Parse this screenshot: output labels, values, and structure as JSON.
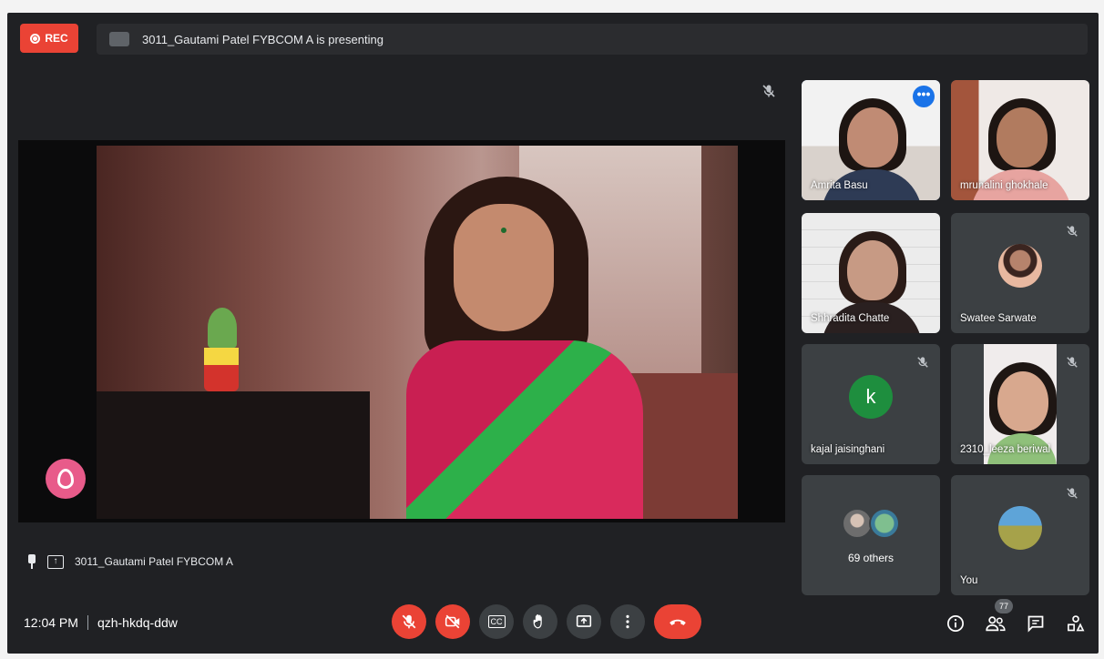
{
  "recording": {
    "label": "REC"
  },
  "presenting_banner": {
    "text": "3011_Gautami Patel FYBCOM A is presenting"
  },
  "presenter_caption": {
    "name": "3011_Gautami Patel FYBCOM A"
  },
  "participants": [
    {
      "name": "Amrita Basu",
      "kind": "video",
      "active": true,
      "muted": false
    },
    {
      "name": "mrunalini ghokhale",
      "kind": "video",
      "active": false,
      "muted": false
    },
    {
      "name": "Shhradita Chatte",
      "kind": "video",
      "active": false,
      "muted": false
    },
    {
      "name": "Swatee Sarwate",
      "kind": "avatar-photo",
      "active": false,
      "muted": true
    },
    {
      "name": "kajal jaisinghani",
      "kind": "avatar-letter",
      "initial": "k",
      "active": false,
      "muted": true
    },
    {
      "name": "2310_leeza beriwal",
      "kind": "video",
      "active": false,
      "muted": true
    }
  ],
  "others_tile": {
    "label": "69 others"
  },
  "self_tile": {
    "label": "You"
  },
  "more_options_label": "•••",
  "meeting": {
    "time": "12:04 PM",
    "code": "qzh-hkdq-ddw"
  },
  "controls": {
    "mic": {
      "state": "off",
      "icon": "mic-off-icon"
    },
    "camera": {
      "state": "off",
      "icon": "camera-off-icon"
    },
    "captions": {
      "label": "CC",
      "icon": "captions-icon"
    },
    "raise_hand": {
      "icon": "hand-icon"
    },
    "present": {
      "icon": "present-icon"
    },
    "more": {
      "icon": "more-vert-icon"
    },
    "leave": {
      "icon": "end-call-icon"
    }
  },
  "right_panel_icons": {
    "people_count": "77"
  },
  "colors": {
    "accent_red": "#ea4335",
    "accent_blue": "#1a73e8",
    "surface": "#202124",
    "tile": "#3c4043"
  }
}
